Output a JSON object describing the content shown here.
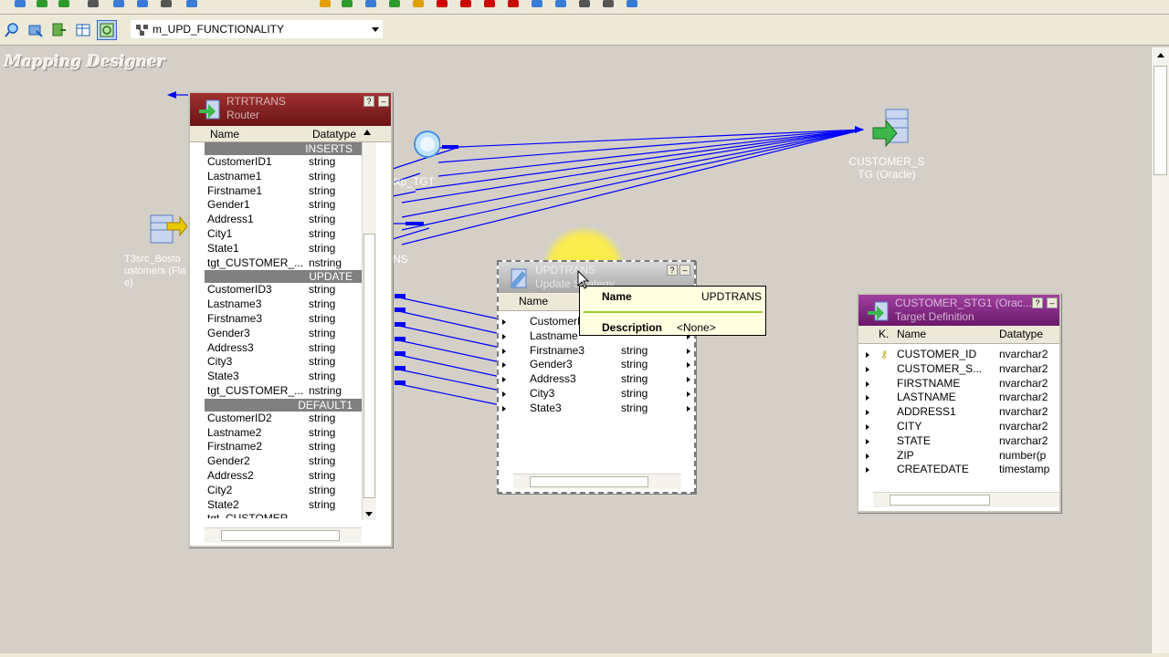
{
  "toolbar": {
    "mapping_name": "m_UPD_FUNCTIONALITY"
  },
  "workspace": {
    "title": "Mapping Designer"
  },
  "router": {
    "name": "RTRTRANS",
    "type": "Router",
    "col_name": "Name",
    "col_type": "Datatype",
    "groups": [
      {
        "label": "INSERTS",
        "rows": [
          {
            "name": "CustomerID1",
            "type": "string"
          },
          {
            "name": "Lastname1",
            "type": "string"
          },
          {
            "name": "Firstname1",
            "type": "string"
          },
          {
            "name": "Gender1",
            "type": "string"
          },
          {
            "name": "Address1",
            "type": "string"
          },
          {
            "name": "City1",
            "type": "string"
          },
          {
            "name": "State1",
            "type": "string"
          },
          {
            "name": "tgt_CUSTOMER_...",
            "type": "nstring"
          }
        ]
      },
      {
        "label": "UPDATE",
        "rows": [
          {
            "name": "CustomerID3",
            "type": "string"
          },
          {
            "name": "Lastname3",
            "type": "string"
          },
          {
            "name": "Firstname3",
            "type": "string"
          },
          {
            "name": "Gender3",
            "type": "string"
          },
          {
            "name": "Address3",
            "type": "string"
          },
          {
            "name": "City3",
            "type": "string"
          },
          {
            "name": "State3",
            "type": "string"
          },
          {
            "name": "tgt_CUSTOMER_...",
            "type": "nstring"
          }
        ]
      },
      {
        "label": "DEFAULT1",
        "rows": [
          {
            "name": "CustomerID2",
            "type": "string"
          },
          {
            "name": "Lastname2",
            "type": "string"
          },
          {
            "name": "Firstname2",
            "type": "string"
          },
          {
            "name": "Gender2",
            "type": "string"
          },
          {
            "name": "Address2",
            "type": "string"
          },
          {
            "name": "City2",
            "type": "string"
          },
          {
            "name": "State2",
            "type": "string"
          },
          {
            "name": "tgt_CUSTOMER_",
            "type": ""
          }
        ]
      }
    ]
  },
  "updtrans": {
    "name": "UPDTRANS",
    "type": "Update Strategy",
    "col_name": "Name",
    "rows": [
      {
        "name": "CustomerI",
        "type": ""
      },
      {
        "name": "Lastname",
        "type": ""
      },
      {
        "name": "Firstname3",
        "type": "string"
      },
      {
        "name": "Gender3",
        "type": "string"
      },
      {
        "name": "Address3",
        "type": "string"
      },
      {
        "name": "City3",
        "type": "string"
      },
      {
        "name": "State3",
        "type": "string"
      }
    ]
  },
  "tooltip": {
    "name_label": "Name",
    "name_value": "UPDTRANS",
    "desc_label": "Description",
    "desc_value": "<None>"
  },
  "target": {
    "name": "CUSTOMER_STG1 (Orac...",
    "type": "Target Definition",
    "col_key": "K.",
    "col_name": "Name",
    "col_type": "Datatype",
    "rows": [
      {
        "name": "CUSTOMER_ID",
        "type": "nvarchar2",
        "key": true
      },
      {
        "name": "CUSTOMER_S...",
        "type": "nvarchar2",
        "key": false
      },
      {
        "name": "FIRSTNAME",
        "type": "nvarchar2",
        "key": false
      },
      {
        "name": "LASTNAME",
        "type": "nvarchar2",
        "key": false
      },
      {
        "name": "ADDRESS1",
        "type": "nvarchar2",
        "key": false
      },
      {
        "name": "CITY",
        "type": "nvarchar2",
        "key": false
      },
      {
        "name": "STATE",
        "type": "nvarchar2",
        "key": false
      },
      {
        "name": "ZIP",
        "type": "number(p",
        "key": false
      },
      {
        "name": "CREATEDATE",
        "type": "timestamp",
        "key": false
      }
    ]
  },
  "nodes": {
    "source_label_1": "T3src_Bosto",
    "source_label_2": "ustomers (Fla",
    "source_label_3": "e)",
    "lookup_label": "lkp_TGT",
    "ns_label": "NS",
    "target_icon_label_1": "CUSTOMER_S",
    "target_icon_label_2": "TG (Oracle)"
  },
  "colors": {
    "link": "#0000ff",
    "router_title": "#8b1a1a",
    "updtrans_title": "#c0c0c0",
    "target_title": "#8b1a8b"
  }
}
